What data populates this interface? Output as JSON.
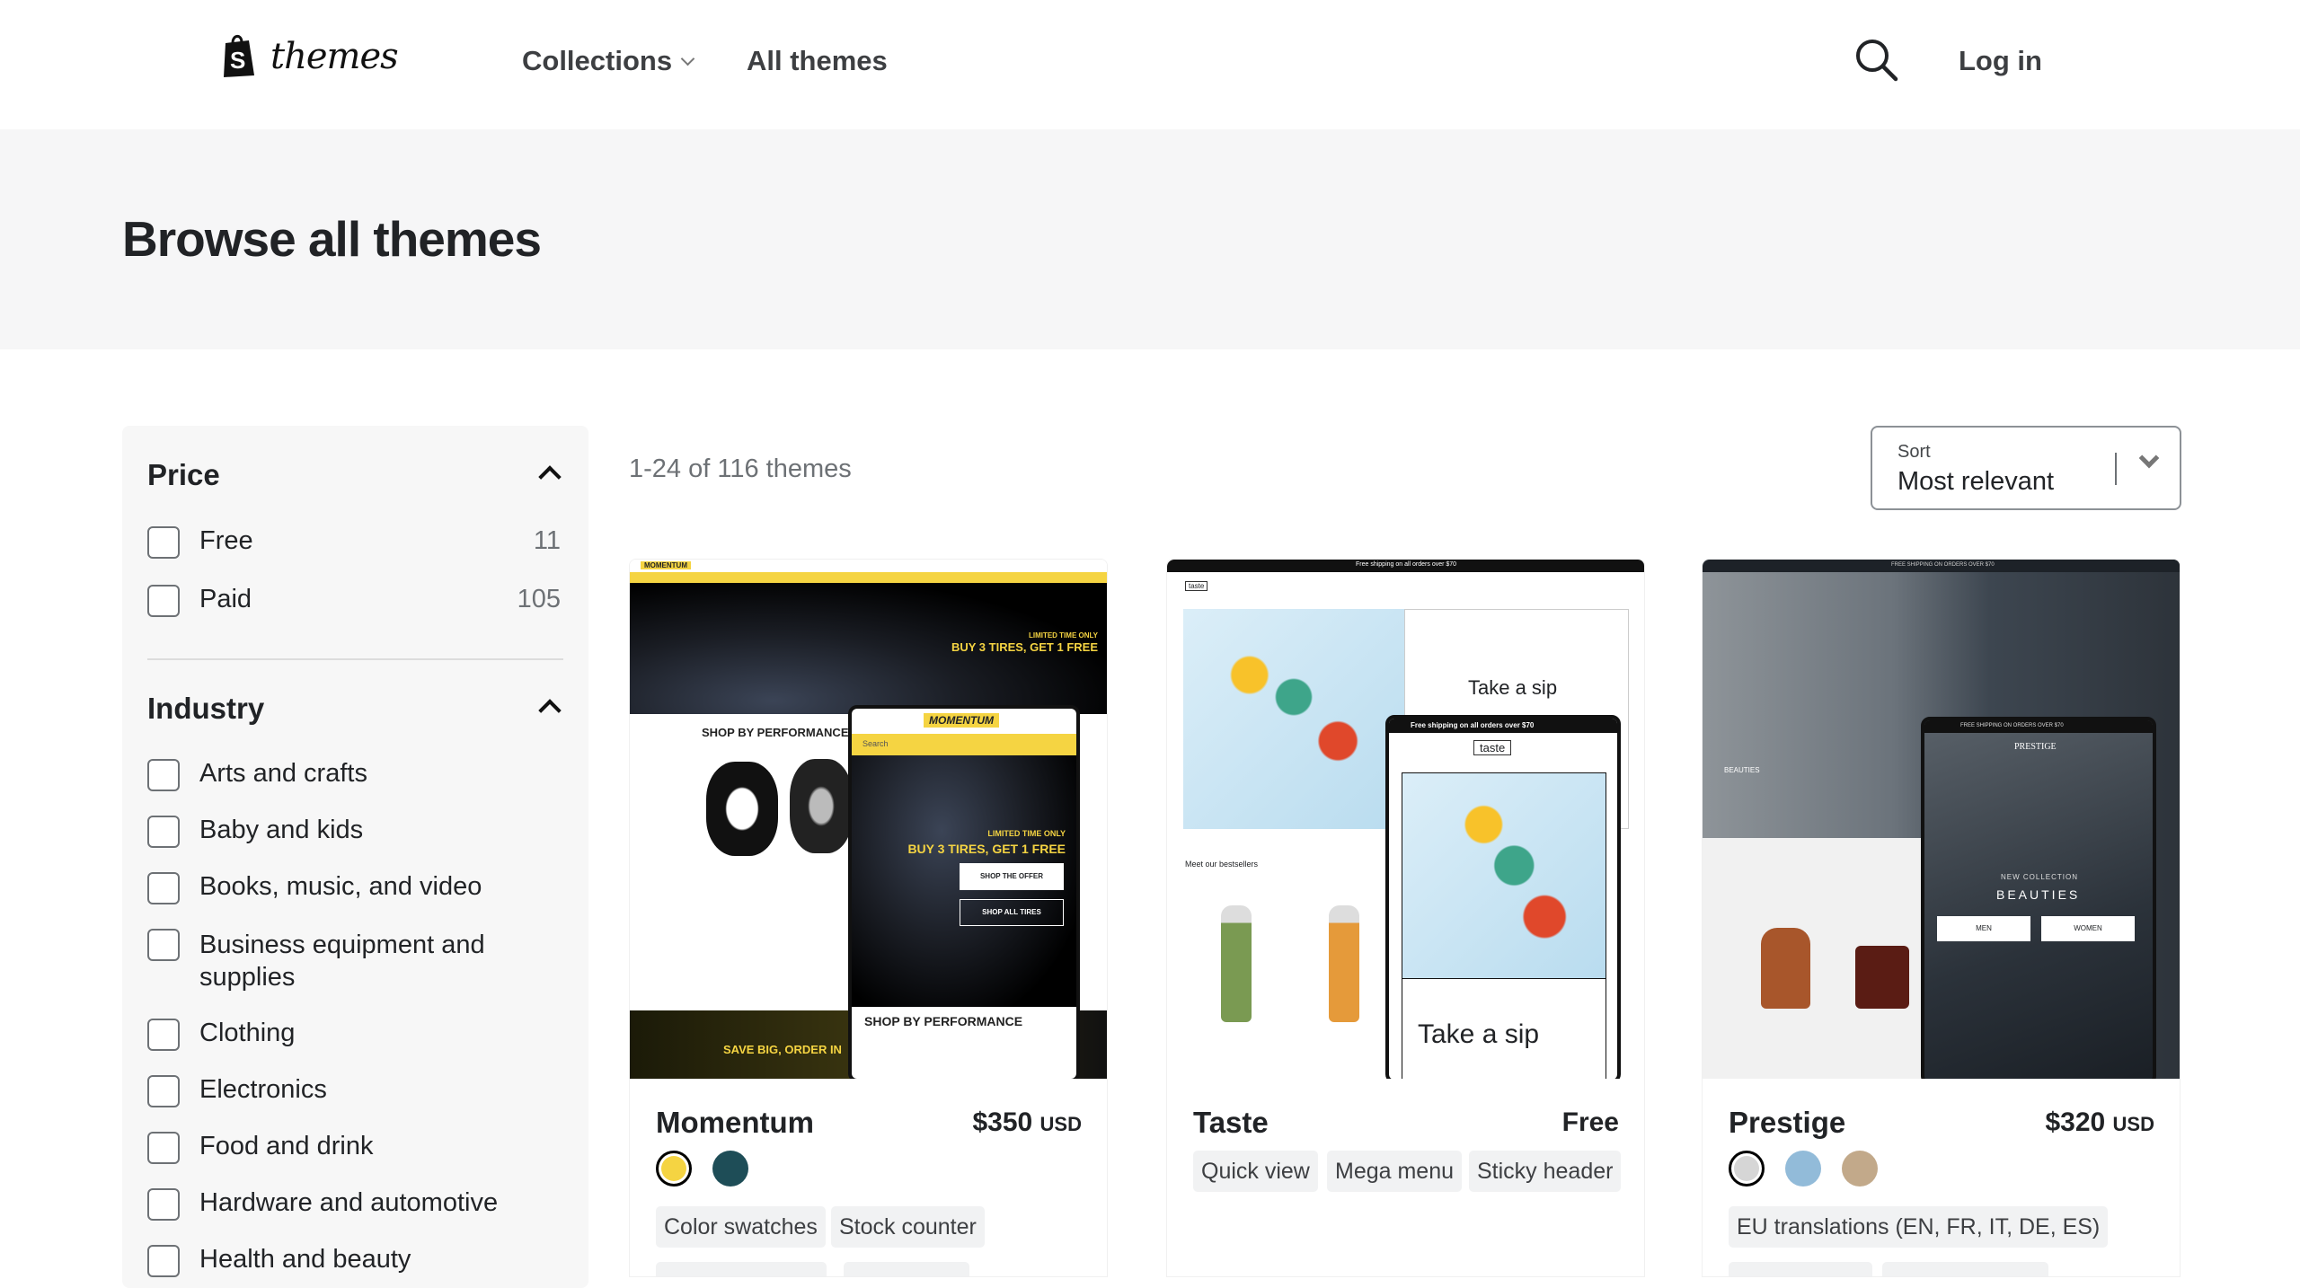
{
  "header": {
    "logo_text": "themes",
    "nav": [
      {
        "label": "Collections",
        "has_dropdown": true
      },
      {
        "label": "All themes"
      }
    ],
    "search_icon": "search-icon",
    "login": "Log in"
  },
  "hero": {
    "title": "Browse all themes"
  },
  "filters": {
    "price": {
      "title": "Price",
      "options": [
        {
          "label": "Free",
          "count": "11"
        },
        {
          "label": "Paid",
          "count": "105"
        }
      ]
    },
    "industry": {
      "title": "Industry",
      "options": [
        "Arts and crafts",
        "Baby and kids",
        "Books, music, and video",
        "Business equipment and supplies",
        "Clothing",
        "Electronics",
        "Food and drink",
        "Hardware and automotive",
        "Health and beauty"
      ]
    }
  },
  "results": {
    "count": "1-24 of 116 themes",
    "sort": {
      "label": "Sort",
      "value": "Most relevant"
    }
  },
  "themes": [
    {
      "name": "Momentum",
      "price": "$350",
      "currency": "USD",
      "swatches": [
        "#f5d442",
        "#1e4d57"
      ],
      "tags": [
        "Color swatches",
        "Stock counter"
      ],
      "preview": {
        "brand": "MOMENTUM",
        "promo_kicker": "LIMITED TIME ONLY",
        "promo": "BUY 3 TIRES, GET 1 FREE",
        "cta1": "SHOP THE OFFER",
        "cta2": "SHOP ALL TIRES",
        "section": "SHOP BY PERFORMANCE",
        "bottom": "SAVE BIG, ORDER IN",
        "search": "Search"
      }
    },
    {
      "name": "Taste",
      "price": "Free",
      "currency": "",
      "swatches": [],
      "tags": [
        "Quick view",
        "Mega menu",
        "Sticky header"
      ],
      "preview": {
        "banner": "Free shipping on all orders over $70",
        "brand": "taste",
        "headline": "Take a sip",
        "section": "Meet our bestsellers"
      }
    },
    {
      "name": "Prestige",
      "price": "$320",
      "currency": "USD",
      "swatches": [
        "#d6d6d6",
        "#92bbd9",
        "#c2a98a"
      ],
      "tags": [
        "EU translations (EN, FR, IT, DE, ES)"
      ],
      "preview": {
        "banner": "FREE SHIPPING ON ORDERS OVER $70",
        "brand": "PRESTIGE",
        "kicker": "NEW COLLECTION",
        "headline": "BEAUTIES",
        "btn1": "MEN",
        "btn2": "WOMEN"
      }
    }
  ]
}
